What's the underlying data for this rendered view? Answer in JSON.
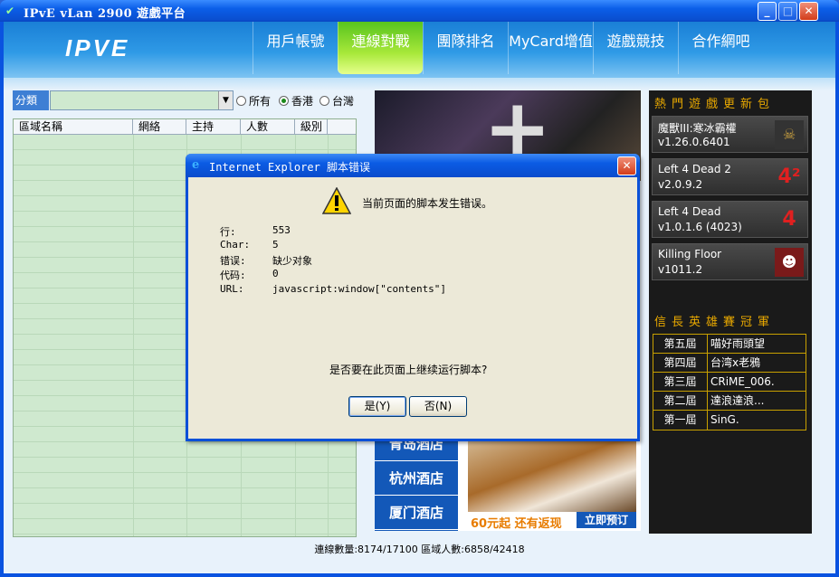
{
  "window": {
    "title": "IPvE vLan 2900 遊戲平台",
    "min": "_",
    "max": "□",
    "close": "✕"
  },
  "header": {
    "logo": "IPVE",
    "nav": [
      "用戶帳號",
      "連線對戰",
      "團隊排名",
      "MyCard增值",
      "遊戲競技",
      "合作網吧"
    ]
  },
  "filter": {
    "label": "分類",
    "select_value": "",
    "radio_all": "所有",
    "radio_hk": "香港",
    "radio_tw": "台灣",
    "selected": "香港"
  },
  "grid": {
    "columns": [
      "區域名稱",
      "網絡",
      "主持",
      "人數",
      "級別"
    ]
  },
  "ads": {
    "hotels": [
      "青岛酒店",
      "杭州酒店",
      "厦门酒店"
    ],
    "price": "60元起 还有返现",
    "book": "立即预订"
  },
  "right": {
    "games_title": "熱門遊戲更新包",
    "games": [
      {
        "name": "魔獸III:寒冰霸權",
        "version": "v1.26.0.6401",
        "icon": "warcraft-icon"
      },
      {
        "name": "Left 4 Dead 2",
        "version": "v2.0.9.2",
        "icon": "l4d2-icon"
      },
      {
        "name": "Left 4 Dead",
        "version": "v1.0.1.6 (4023)",
        "icon": "l4d-icon"
      },
      {
        "name": "Killing Floor",
        "version": "v1011.2",
        "icon": "killing-floor-icon"
      }
    ],
    "champ_title": "信長英雄賽冠軍",
    "champions": [
      {
        "rank": "第五屆",
        "name": "喵好雨頭望"
      },
      {
        "rank": "第四屆",
        "name": "台湾x老鴉"
      },
      {
        "rank": "第三屆",
        "name": "CRiME_006."
      },
      {
        "rank": "第二屆",
        "name": "達浪達浪..."
      },
      {
        "rank": "第一屆",
        "name": "SinG."
      }
    ]
  },
  "status": {
    "text": "連線數量:8174/17100    區域人數:6858/42418"
  },
  "dialog": {
    "title": "Internet Explorer 脚本错误",
    "message": "当前页面的脚本发生错误。",
    "labels": [
      "行:",
      "Char:",
      "错误:",
      "代码:",
      "URL:"
    ],
    "values": [
      "553",
      "5",
      "缺少对象",
      "0",
      "javascript:window[\"contents\"]"
    ],
    "question": "是否要在此页面上继续运行脚本?",
    "yes": "是(Y)",
    "no": "否(N)"
  }
}
